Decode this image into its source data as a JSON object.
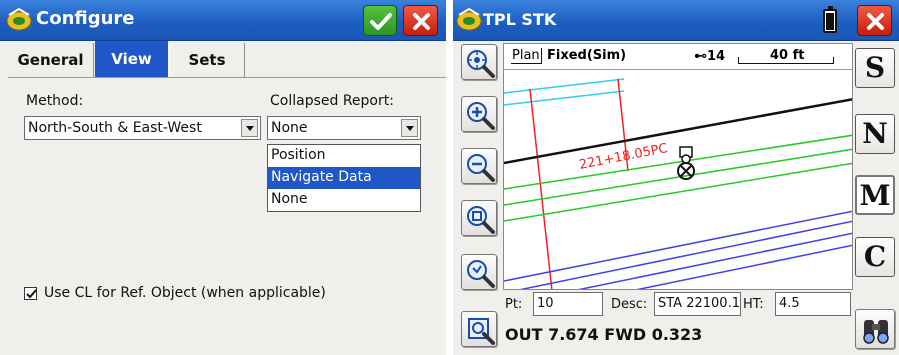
{
  "left_window": {
    "title": "Configure",
    "tabs": [
      {
        "label": "General",
        "active": false
      },
      {
        "label": "View",
        "active": true
      },
      {
        "label": "Sets",
        "active": false
      }
    ],
    "method": {
      "label": "Method:",
      "value": "North-South & East-West"
    },
    "collapsed_report": {
      "label": "Collapsed Report:",
      "value": "None",
      "options": [
        "Position",
        "Navigate Data",
        "None"
      ],
      "highlighted": "Navigate Data"
    },
    "use_cl_checkbox": {
      "label": "Use CL for Ref. Object (when applicable)",
      "checked": true
    }
  },
  "right_window": {
    "title": "TPL STK",
    "map_header": {
      "view_mode": "Plan",
      "fix_status": "Fixed(Sim)",
      "satellites": "14",
      "scale": "40 ft"
    },
    "map_annotation": "221+18.05PC",
    "side_buttons": [
      "S",
      "N",
      "M",
      "C"
    ],
    "point": {
      "label": "Pt:",
      "value": "10"
    },
    "description": {
      "label": "Desc:",
      "value": "STA 22100.1"
    },
    "height": {
      "label": "HT:",
      "value": "4.5"
    },
    "status_line": "OUT 7.674 FWD 0.323",
    "tools": [
      "zoom-extents-icon",
      "zoom-in-icon",
      "zoom-out-icon",
      "zoom-window-icon",
      "zoom-previous-icon",
      "map-settings-icon"
    ]
  },
  "colors": {
    "titlebar": "#1d5fc2",
    "selection": "#1f58c6",
    "ok_button": "#2d9424",
    "close_button": "#c81c0e",
    "line_cyan": "#33ccee",
    "line_green": "#22cc22",
    "line_blue": "#4040ee",
    "line_red": "#ee2222"
  }
}
